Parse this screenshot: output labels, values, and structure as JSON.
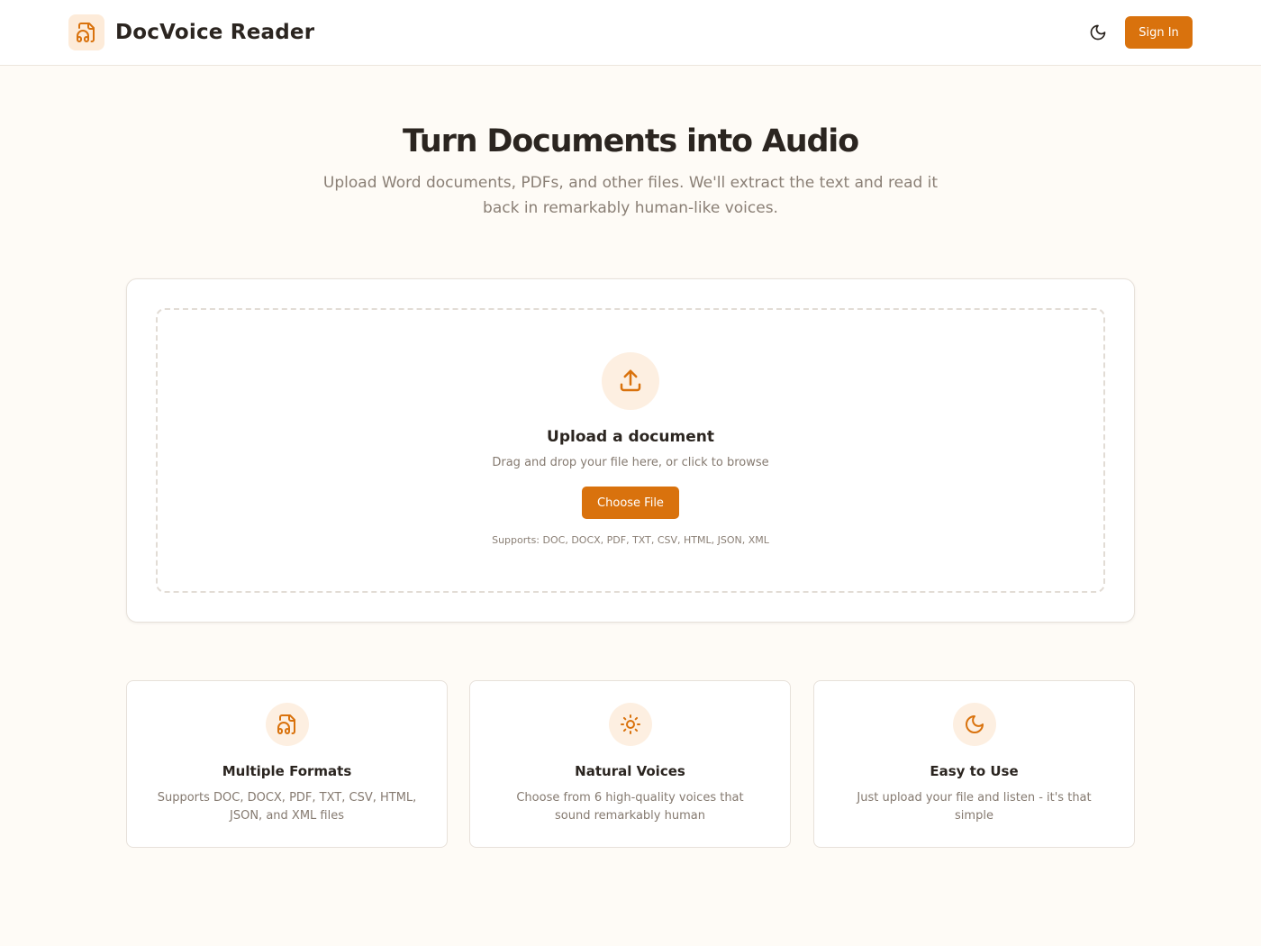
{
  "header": {
    "app_title": "DocVoice Reader",
    "logo_icon": "file-audio-icon",
    "theme_toggle_icon": "moon-icon",
    "signin_label": "Sign In"
  },
  "hero": {
    "title": "Turn Documents into Audio",
    "subtitle": "Upload Word documents, PDFs, and other files. We'll extract the text and read it back in remarkably human-like voices."
  },
  "upload": {
    "icon": "upload-icon",
    "title": "Upload a document",
    "hint": "Drag and drop your file here, or click to browse",
    "button_label": "Choose File",
    "supports": "Supports: DOC, DOCX, PDF, TXT, CSV, HTML, JSON, XML"
  },
  "features": [
    {
      "icon": "file-audio-icon",
      "title": "Multiple Formats",
      "description": "Supports DOC, DOCX, PDF, TXT, CSV, HTML, JSON, and XML files"
    },
    {
      "icon": "sun-icon",
      "title": "Natural Voices",
      "description": "Choose from 6 high-quality voices that sound remarkably human"
    },
    {
      "icon": "moon-icon",
      "title": "Easy to Use",
      "description": "Just upload your file and listen - it's that simple"
    }
  ],
  "colors": {
    "accent": "#d9720d",
    "accent_soft": "#fdefe1",
    "background": "#fefbf6"
  }
}
